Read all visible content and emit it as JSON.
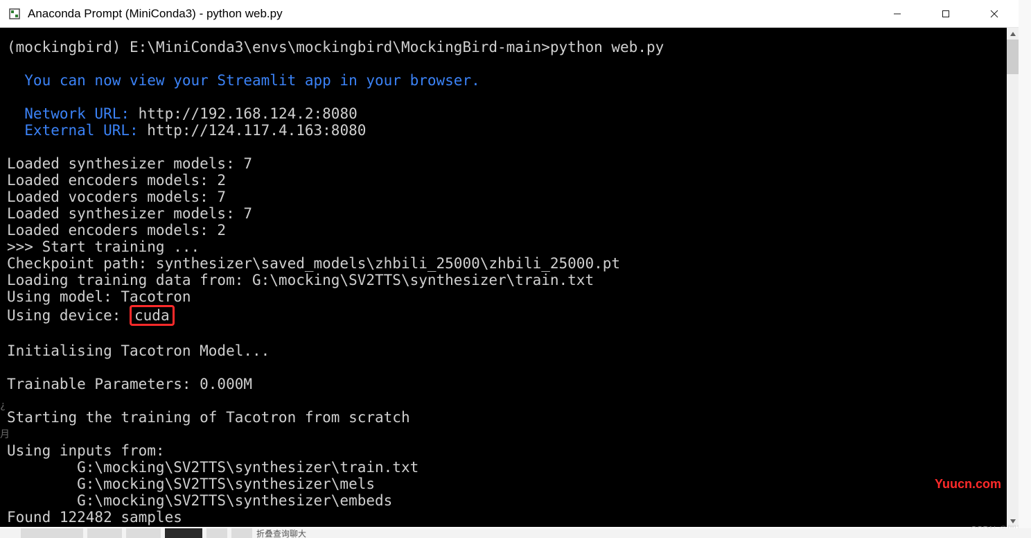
{
  "window": {
    "title": "Anaconda Prompt (MiniConda3) - python  web.py"
  },
  "terminal": {
    "prompt_env": "(mockingbird) ",
    "prompt_path": "E:\\MiniConda3\\envs\\mockingbird\\MockingBird-main>",
    "prompt_cmd": "python web.py",
    "streamlit_msg": "  You can now view your Streamlit app in your browser.",
    "network_label": "  Network URL: ",
    "network_url": "http://192.168.124.2:8080",
    "external_label": "  External URL: ",
    "external_url": "http://124.117.4.163:8080",
    "lines": [
      "Loaded synthesizer models: 7",
      "Loaded encoders models: 2",
      "Loaded vocoders models: 7",
      "Loaded synthesizer models: 7",
      "Loaded encoders models: 2",
      ">>> Start training ...",
      "Checkpoint path: synthesizer\\saved_models\\zhbili_25000\\zhbili_25000.pt",
      "Loading training data from: G:\\mocking\\SV2TTS\\synthesizer\\train.txt",
      "Using model: Tacotron"
    ],
    "device_label": "Using device: ",
    "device_value": "cuda",
    "after_device": [
      "",
      "Initialising Tacotron Model...",
      "",
      "Trainable Parameters: 0.000M",
      "",
      "Starting the training of Tacotron from scratch",
      "",
      "Using inputs from:",
      "        G:\\mocking\\SV2TTS\\synthesizer\\train.txt",
      "        G:\\mocking\\SV2TTS\\synthesizer\\mels",
      "        G:\\mocking\\SV2TTS\\synthesizer\\embeds",
      "Found 122482 samples"
    ],
    "left_fragments": {
      "a": "¿",
      "b": "月"
    }
  },
  "watermarks": {
    "yuucn": "Yuucn.com",
    "csdn": "CSDN @圆崽"
  },
  "taskbar": {
    "text": "折叠查询聊大"
  }
}
